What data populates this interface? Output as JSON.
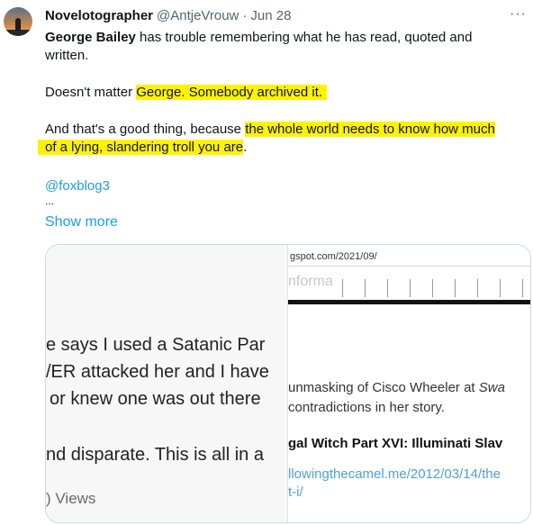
{
  "tweet": {
    "author_name": "Novelotographer",
    "handle": "@AntjeVrouw",
    "separator": "·",
    "date": "Jun 28",
    "more_icon": "···",
    "lines": {
      "l1": "George Bailey has trouble remembering what he has read, quoted and",
      "l1_name": "George Bailey",
      "l1_rest": " has trouble remembering what he has read, quoted and",
      "l2": "written.",
      "l3_pre": "Doesn't matter ",
      "l3_hl": "George. Somebody archived it.",
      "l4_pre": "And that's a good thing, because ",
      "l4_hl": "the whole world needs to know how much",
      "l5_hl": "of a lying, slandering troll you are",
      "l5_post": ".",
      "mention": "@foxblog3",
      "ellipsis": "...",
      "show_more": "Show more"
    }
  },
  "media": {
    "left": {
      "line1": "e says I used a Satanic Par",
      "line2": "/ER attacked her and I have",
      "line3": "or knew one was out there",
      "line4": "nd disparate.  This is all in a",
      "views": ") Views"
    },
    "right": {
      "url": "gspot.com/2021/09/",
      "ghost": "nforma",
      "text1": "unmasking of Cisco Wheeler at Swa",
      "text1_pre": "unmasking of Cisco Wheeler at ",
      "text1_it": "Swa",
      "text2": "contradictions in her story.",
      "bold": "gal Witch Part XVI: Illuminati Slav",
      "link1": "llowingthecamel.me/2012/03/14/the",
      "link2": "t-i/"
    }
  },
  "colors": {
    "highlight": "#fff200",
    "link": "#1d9bf0",
    "secondary_text": "#536471"
  }
}
